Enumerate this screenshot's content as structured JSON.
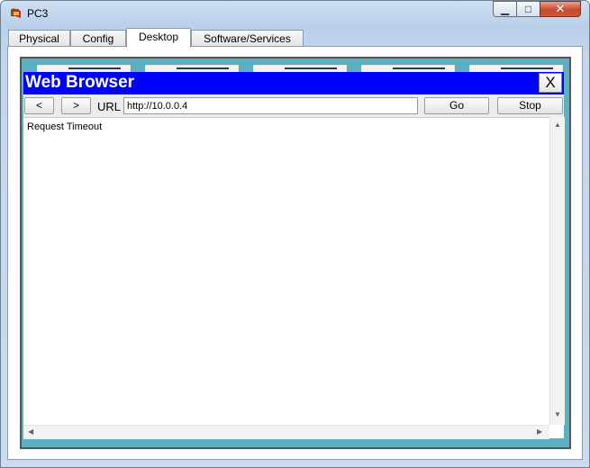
{
  "window": {
    "title": "PC3",
    "icon": "packet-tracer-pc-icon",
    "minimize_glyph": "▁",
    "maximize_glyph": "□",
    "close_glyph": "✕"
  },
  "tabs": [
    {
      "label": "Physical"
    },
    {
      "label": "Config"
    },
    {
      "label": "Desktop",
      "active": true
    },
    {
      "label": "Software/Services"
    }
  ],
  "browser": {
    "title": "Web Browser",
    "close_label": "X",
    "back_label": "<",
    "forward_label": ">",
    "url_label": "URL",
    "url_value": "http://10.0.0.4",
    "go_label": "Go",
    "stop_label": "Stop",
    "content_text": "Request Timeout"
  },
  "colors": {
    "browser_header": "#0000ff",
    "desktop_background": "#5ab1c1"
  }
}
